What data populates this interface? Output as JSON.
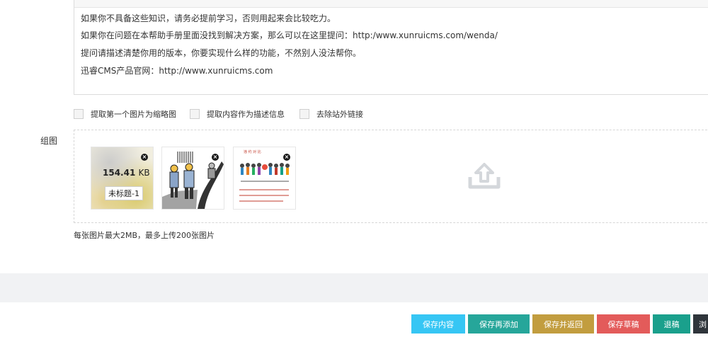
{
  "editor": {
    "lines": [
      "如果你不具备这些知识，请务必提前学习，否则用起来会比较吃力。",
      "如果你在问题在本帮助手册里面没找到解决方案，那么可以在这里提问：http:/www.xunruicms.com/wenda/",
      "提问请描述清楚你用的版本，你要实现什么样的功能，不然别人没法帮你。",
      "迅睿CMS产品官网：http://www.xunruicms.com"
    ]
  },
  "options": [
    {
      "label": "提取第一个图片为缩略图",
      "checked": false
    },
    {
      "label": "提取内容作为描述信息",
      "checked": false
    },
    {
      "label": "去除站外链接",
      "checked": false
    }
  ],
  "gallery": {
    "label": "组图",
    "images": [
      {
        "size_value": "154.41",
        "size_unit": "KB",
        "name": "未标题-1",
        "remove_icon": "×"
      },
      {
        "remove_icon": "×"
      },
      {
        "caption": "违 约 对 比",
        "remove_icon": "×"
      }
    ],
    "upload_icon": "upload-icon",
    "hint": "每张图片最大2MB，最多上传200张图片"
  },
  "actions": {
    "save": "保存内容",
    "save_add": "保存再添加",
    "save_back": "保存并返回",
    "draft": "保存草稿",
    "back": "退稿",
    "more": "浏"
  },
  "colors": {
    "save": "#36c6f4",
    "save_add": "#26a69a",
    "save_back": "#c29d3f",
    "draft": "#e35b5a",
    "back": "#1aa08c",
    "more": "#2f353b"
  }
}
